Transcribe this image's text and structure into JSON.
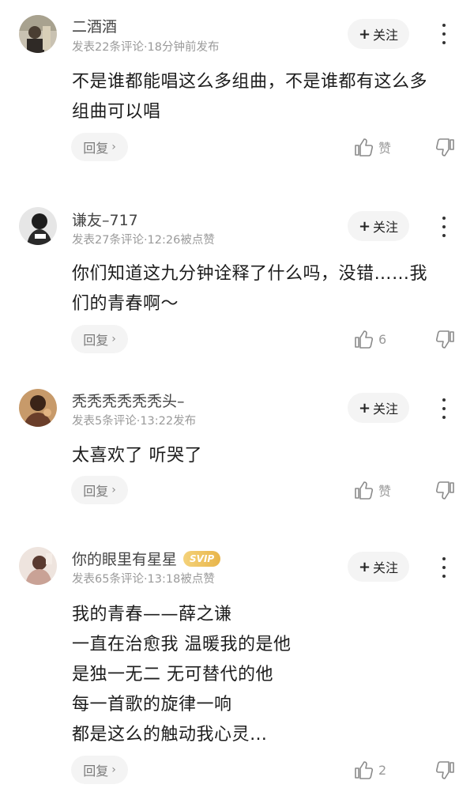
{
  "follow_label": "关注",
  "reply_label": "回复",
  "comments": [
    {
      "username": "二酒酒",
      "meta": "发表22条评论·18分钟前发布",
      "content": [
        "不是谁都能唱这么多组曲，不是谁都有这么多",
        "组曲可以唱"
      ],
      "like_text": "赞",
      "avatar_color": "#9a9a88"
    },
    {
      "username": "谦友–717",
      "meta": "发表27条评论·12:26被点赞",
      "content": [
        "你们知道这九分钟诠释了什么吗，没错……我",
        "们的青春啊～"
      ],
      "like_text": "6",
      "avatar_color": "#2a2a2a"
    },
    {
      "username": "秃秃秃秃秃秃头–",
      "meta": "发表5条评论·13:22发布",
      "content": [
        "太喜欢了 听哭了"
      ],
      "like_text": "赞",
      "avatar_color": "#7a4a3a"
    },
    {
      "username": "你的眼里有星星",
      "vip": "SVIP",
      "meta": "发表65条评论·13:18被点赞",
      "content": [
        "我的青春——薛之谦",
        "一直在治愈我 温暖我的是他",
        "是独一无二 无可替代的他",
        "每一首歌的旋律一响",
        "都是这么的触动我心灵…"
      ],
      "like_text": "2",
      "avatar_color": "#b89488"
    }
  ]
}
